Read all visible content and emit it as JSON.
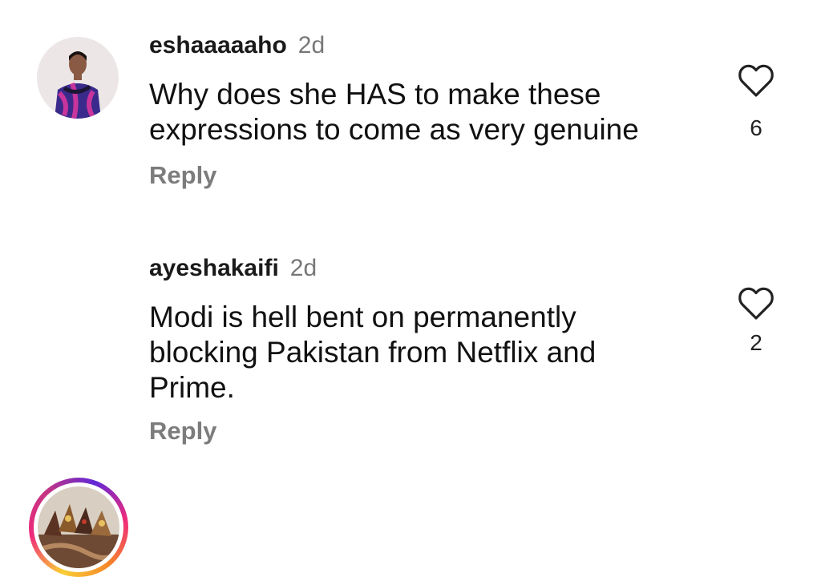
{
  "comments": [
    {
      "username": "eshaaaaaho",
      "time": "2d",
      "text_lines": [
        "Why does she HAS to make these",
        "expressions to come as very genuine"
      ],
      "reply_label": "Reply",
      "likes": "6",
      "avatar_icon": "profile-photo-avatar",
      "has_story_ring": false
    },
    {
      "username": "ayeshakaifi",
      "time": "2d",
      "text_lines": [
        "Modi is hell bent on permanently",
        "blocking Pakistan from Netflix and",
        "Prime."
      ],
      "reply_label": "Reply",
      "likes": "2",
      "avatar_icon": "profile-photo-avatar",
      "has_story_ring": true
    }
  ],
  "icons": {
    "like": "heart-outline-icon"
  },
  "colors": {
    "story_ring_start": "#f9ce34",
    "story_ring_mid": "#ee2a7b",
    "story_ring_end": "#6228d7",
    "muted_text": "#7c7c7c"
  }
}
